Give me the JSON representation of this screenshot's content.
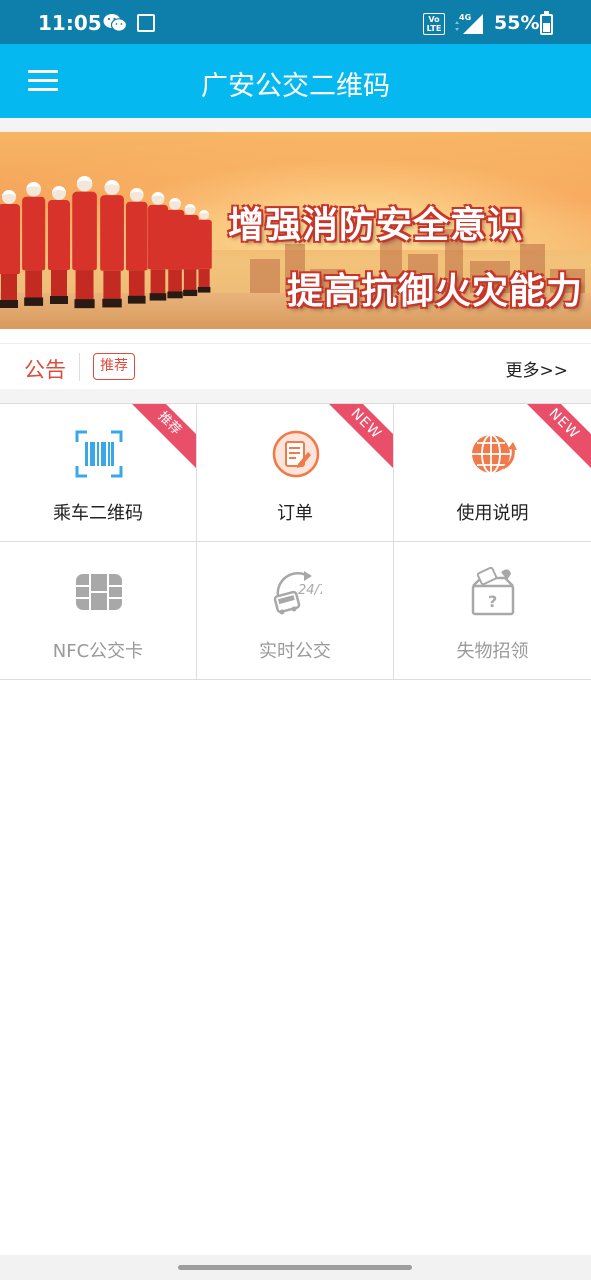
{
  "status_bar": {
    "time": "11:05",
    "volte_line1": "Vo",
    "volte_line2": "LTE",
    "network": "4G",
    "battery": "55%",
    "battery_level": 0.55,
    "icons": [
      "wechat-icon",
      "gallery-icon",
      "volte-icon",
      "signal-icon",
      "battery-icon"
    ]
  },
  "app_bar": {
    "title": "广安公交二维码",
    "menu_icon": "hamburger-menu-icon"
  },
  "banner": {
    "slogan_line1": "增强消防安全意识",
    "slogan_line2": "提高抗御火灾能力",
    "slide_count": 2,
    "active_slide": 1
  },
  "notice": {
    "label": "公告",
    "tag": "推荐",
    "more": "更多>>"
  },
  "grid": {
    "items": [
      {
        "label": "乘车二维码",
        "icon": "qr-scan-icon",
        "ribbon": "推荐",
        "enabled": true
      },
      {
        "label": "订单",
        "icon": "order-edit-icon",
        "ribbon": "NEW",
        "enabled": true
      },
      {
        "label": "使用说明",
        "icon": "globe-arrow-icon",
        "ribbon": "NEW",
        "enabled": true
      },
      {
        "label": "NFC公交卡",
        "icon": "nfc-chip-icon",
        "ribbon": "",
        "enabled": false
      },
      {
        "label": "实时公交",
        "icon": "bus-24-7-icon",
        "ribbon": "",
        "enabled": false
      },
      {
        "label": "失物招领",
        "icon": "lost-found-box-icon",
        "ribbon": "",
        "enabled": false
      }
    ]
  },
  "colors": {
    "status_bar": "#0e7eaa",
    "app_bar": "#06b8f0",
    "accent_red": "#e04c3c",
    "ribbon": "#ea4f6a",
    "icon_blue": "#3aa8e8",
    "icon_orange": "#f07a4a",
    "disabled_gray": "#9a9a9a"
  }
}
